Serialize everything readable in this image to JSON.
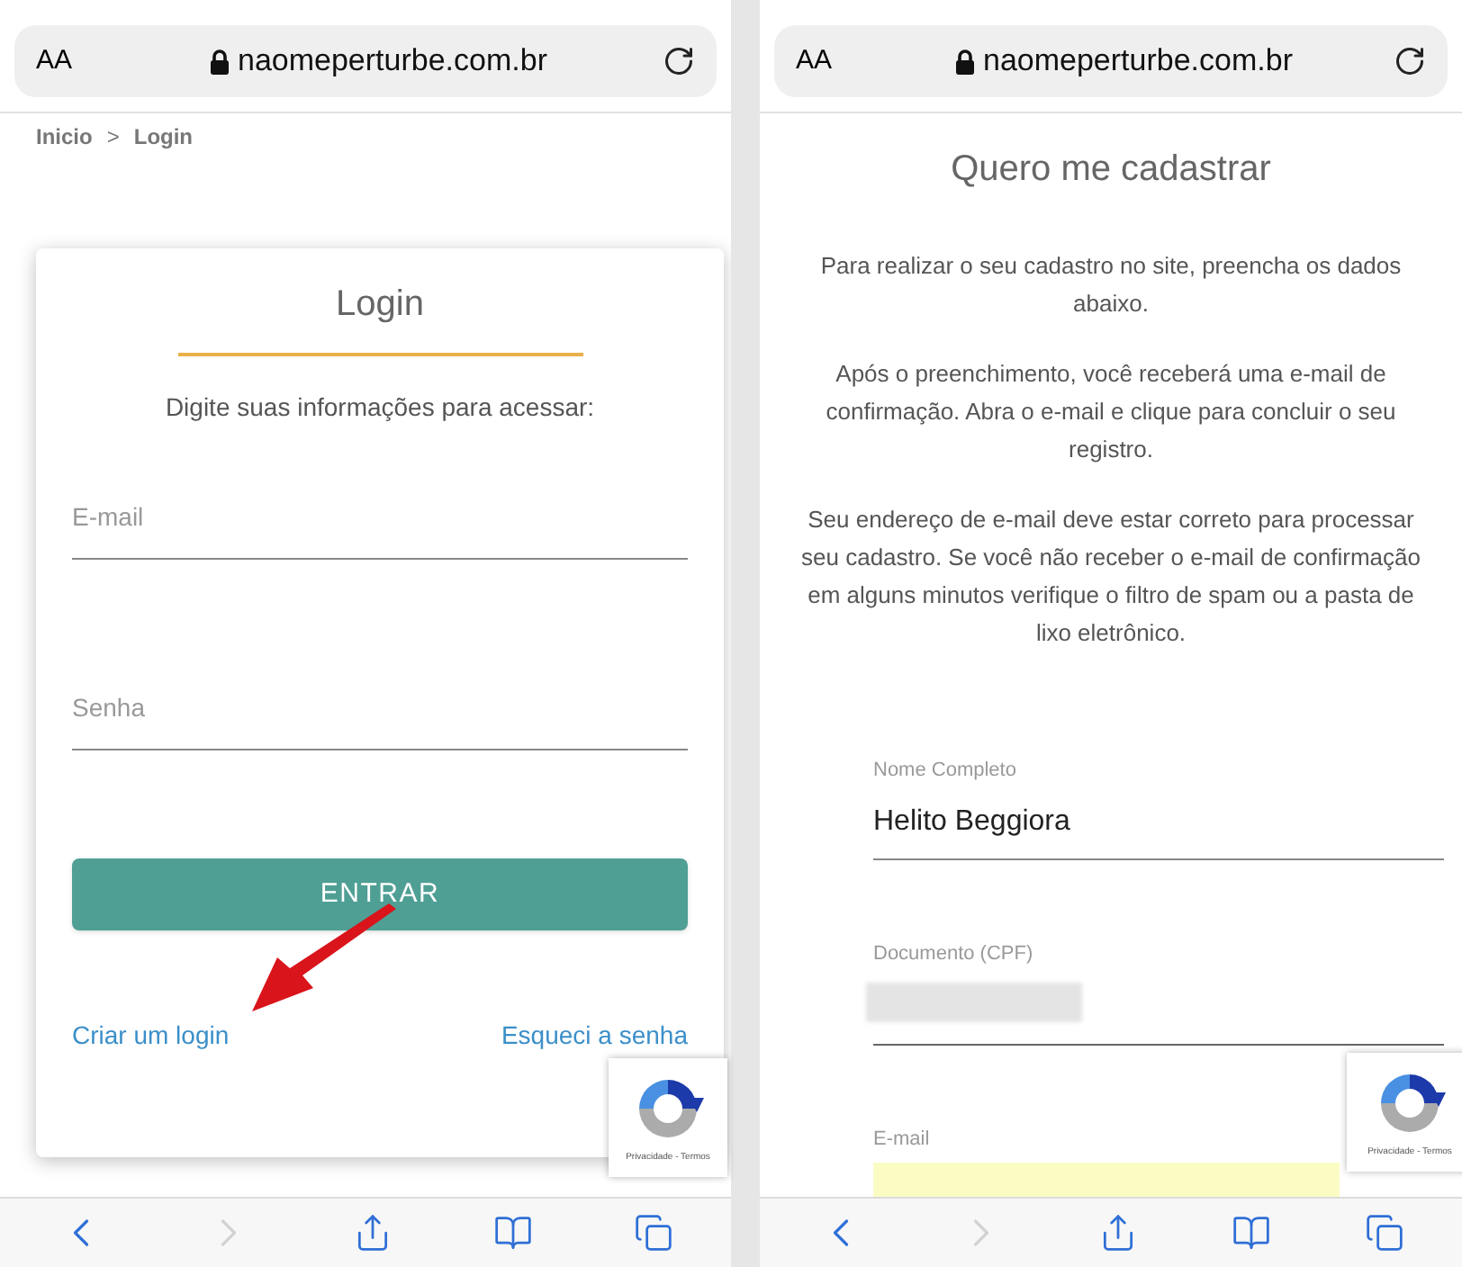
{
  "left_screen": {
    "address_bar": {
      "text_size": "AA",
      "url": "naomeperturbe.com.br"
    },
    "breadcrumb": {
      "items": [
        "Inicio",
        "Login"
      ],
      "separator": ">"
    },
    "login_card": {
      "title": "Login",
      "subtitle": "Digite suas informações para acessar:",
      "fields": [
        {
          "placeholder": "E-mail"
        },
        {
          "placeholder": "Senha"
        }
      ],
      "button": "ENTRAR",
      "links": [
        "Criar um login",
        "Esqueci a senha"
      ]
    },
    "recaptcha": {
      "text": "Privacidade - Termos"
    },
    "toolbar": [
      {
        "kind": "back",
        "disabled": false
      },
      {
        "kind": "forward",
        "disabled": true
      },
      {
        "kind": "share",
        "disabled": false
      },
      {
        "kind": "bookmarks",
        "disabled": false
      },
      {
        "kind": "tabs",
        "disabled": false
      }
    ]
  },
  "right_screen": {
    "address_bar": {
      "text_size": "AA",
      "url": "naomeperturbe.com.br"
    },
    "heading": "Quero me cadastrar",
    "paragraphs": [
      "Para realizar o seu cadastro no site, preencha os dados abaixo.",
      "Após o preenchimento, você receberá uma e-mail de confirmação. Abra o e-mail e clique para concluir o seu registro.",
      "Seu endereço de e-mail deve estar correto para processar seu cadastro. Se você não receber o e-mail de confirmação em alguns minutos verifique o filtro de spam ou a pasta de lixo eletrônico."
    ],
    "fields": [
      {
        "kind": "text",
        "label": "Nome Completo",
        "value": "Helito Beggiora"
      },
      {
        "kind": "redacted",
        "label": "Documento (CPF)"
      },
      {
        "kind": "highlighted",
        "label": "E-mail"
      }
    ],
    "recaptcha": {
      "text": "Privacidade - Termos"
    },
    "toolbar": [
      {
        "kind": "back",
        "disabled": false
      },
      {
        "kind": "forward",
        "disabled": true
      },
      {
        "kind": "share",
        "disabled": false
      },
      {
        "kind": "bookmarks",
        "disabled": false
      },
      {
        "kind": "tabs",
        "disabled": false
      }
    ]
  }
}
